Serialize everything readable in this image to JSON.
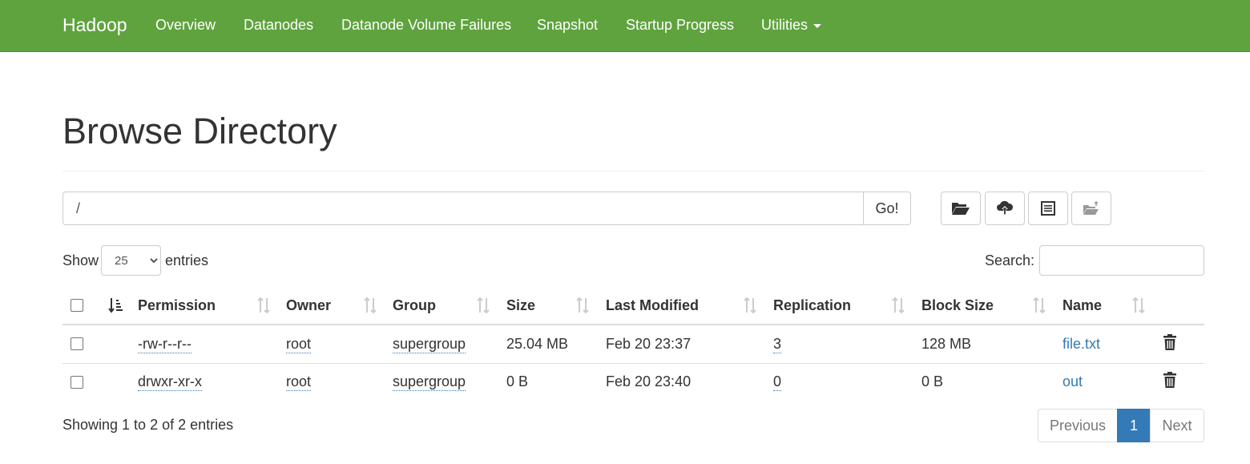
{
  "navbar": {
    "brand": "Hadoop",
    "items": [
      "Overview",
      "Datanodes",
      "Datanode Volume Failures",
      "Snapshot",
      "Startup Progress",
      "Utilities"
    ],
    "color": "#5fa33e"
  },
  "page": {
    "title": "Browse Directory"
  },
  "path": {
    "value": "/",
    "go_label": "Go!"
  },
  "toolbar": {
    "icons": [
      "folder-open-icon",
      "cloud-upload-icon",
      "list-alt-icon",
      "move-folder-icon"
    ]
  },
  "length": {
    "show_label": "Show",
    "value": "25",
    "entries_label": "entries"
  },
  "search": {
    "label": "Search:"
  },
  "table": {
    "columns": [
      "Permission",
      "Owner",
      "Group",
      "Size",
      "Last Modified",
      "Replication",
      "Block Size",
      "Name"
    ],
    "rows": [
      {
        "permission": "-rw-r--r--",
        "owner": "root",
        "group": "supergroup",
        "size": "25.04 MB",
        "modified": "Feb 20 23:37",
        "replication": "3",
        "block_size": "128 MB",
        "name": "file.txt"
      },
      {
        "permission": "drwxr-xr-x",
        "owner": "root",
        "group": "supergroup",
        "size": "0 B",
        "modified": "Feb 20 23:40",
        "replication": "0",
        "block_size": "0 B",
        "name": "out"
      }
    ]
  },
  "footer": {
    "info": "Showing 1 to 2 of 2 entries",
    "previous": "Previous",
    "page": "1",
    "next": "Next"
  },
  "colors": {
    "link": "#337ab7",
    "active_page": "#337ab7"
  }
}
